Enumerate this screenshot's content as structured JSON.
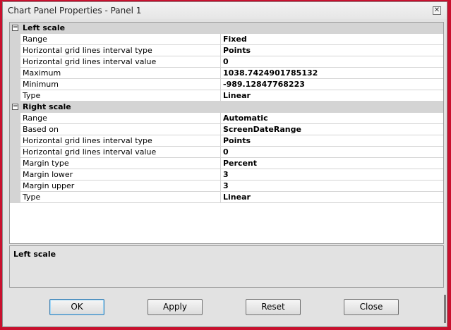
{
  "window": {
    "title": "Chart Panel Properties - Panel 1",
    "close_glyph": "✕"
  },
  "property_grid": {
    "left_scale": {
      "label": "Left scale",
      "toggle": "−",
      "rows": [
        {
          "name": "Range",
          "value": "Fixed"
        },
        {
          "name": "Horizontal grid lines interval type",
          "value": "Points"
        },
        {
          "name": "Horizontal grid lines interval value",
          "value": "0"
        },
        {
          "name": "Maximum",
          "value": "1038.7424901785132"
        },
        {
          "name": "Minimum",
          "value": "-989.12847768223"
        },
        {
          "name": "Type",
          "value": "Linear"
        }
      ]
    },
    "right_scale": {
      "label": "Right scale",
      "toggle": "−",
      "rows": [
        {
          "name": "Range",
          "value": "Automatic"
        },
        {
          "name": "Based on",
          "value": "ScreenDateRange"
        },
        {
          "name": "Horizontal grid lines interval type",
          "value": "Points"
        },
        {
          "name": "Horizontal grid lines interval value",
          "value": "0"
        },
        {
          "name": "Margin type",
          "value": "Percent"
        },
        {
          "name": "Margin lower",
          "value": "3"
        },
        {
          "name": "Margin upper",
          "value": "3"
        },
        {
          "name": "Type",
          "value": "Linear"
        }
      ]
    }
  },
  "description": {
    "title": "Left scale"
  },
  "buttons": {
    "ok": "OK",
    "apply": "Apply",
    "reset": "Reset",
    "close": "Close"
  }
}
